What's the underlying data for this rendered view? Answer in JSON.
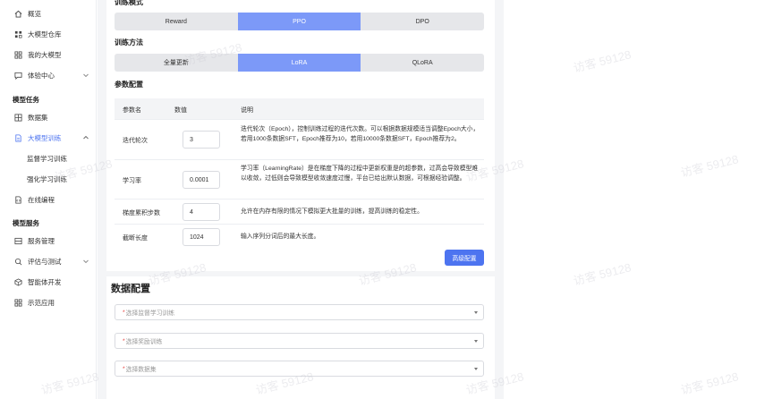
{
  "sidebar": {
    "items": [
      {
        "label": "概览",
        "icon": "home-icon"
      },
      {
        "label": "大模型仓库",
        "icon": "grid-icon"
      },
      {
        "label": "我的大模型",
        "icon": "apps-icon"
      },
      {
        "label": "体验中心",
        "icon": "chat-icon"
      }
    ],
    "group_tasks": "模型任务",
    "task_items": [
      {
        "label": "数据集",
        "icon": "table-icon"
      },
      {
        "label": "大模型训练",
        "icon": "doc-icon"
      }
    ],
    "sub_items": [
      "监督学习训练",
      "强化学习训练"
    ],
    "online_coding": "在线编程",
    "group_services": "模型服务",
    "service_items": [
      {
        "label": "服务管理",
        "icon": "server-icon"
      },
      {
        "label": "评估与测试",
        "icon": "eval-icon"
      },
      {
        "label": "智能体开发",
        "icon": "agent-icon"
      },
      {
        "label": "示范应用",
        "icon": "apps-icon"
      }
    ]
  },
  "training": {
    "mode_label": "训练模式",
    "modes": [
      "Reward",
      "PPO",
      "DPO"
    ],
    "mode_selected": "PPO",
    "method_label": "训练方法",
    "methods": [
      "全量更新",
      "LoRA",
      "QLoRA"
    ],
    "method_selected": "LoRA",
    "params_label": "参数配置",
    "table_headers": [
      "参数名",
      "数值",
      "说明"
    ],
    "params": [
      {
        "name": "迭代轮次",
        "value": "3",
        "desc": "迭代轮次（Epoch），控制训练过程的迭代次数。可以根据数据规模适当调整Epoch大小，若用1000条数据SFT，Epoch推荐为10，若用10000条数据SFT，Epoch推荐为2。"
      },
      {
        "name": "学习率",
        "value": "0.0001",
        "desc": "学习率（LearningRate）是在梯度下降的过程中更新权重是的超参数，过高会导致模型难以收敛，过低则会导致模型收敛速度过慢，平台已给出默认数据，可根据经验调整。"
      },
      {
        "name": "梯度累积步数",
        "value": "4",
        "desc": "允许在内存有限的情况下模拟更大批量的训练，提高训练的稳定性。"
      },
      {
        "name": "截断长度",
        "value": "1024",
        "desc": "输入序列分词后的最大长度。"
      }
    ],
    "advanced_button": "高级配置"
  },
  "data_config": {
    "title": "数据配置",
    "selects": [
      {
        "placeholder": "选择监督学习训练"
      },
      {
        "placeholder": "选择奖励训练"
      },
      {
        "placeholder": "选择数据集"
      }
    ]
  },
  "watermark": "访客 59128",
  "colors": {
    "accent": "#4d74f0",
    "segment_active": "#7c99f8",
    "required": "#e53935"
  }
}
